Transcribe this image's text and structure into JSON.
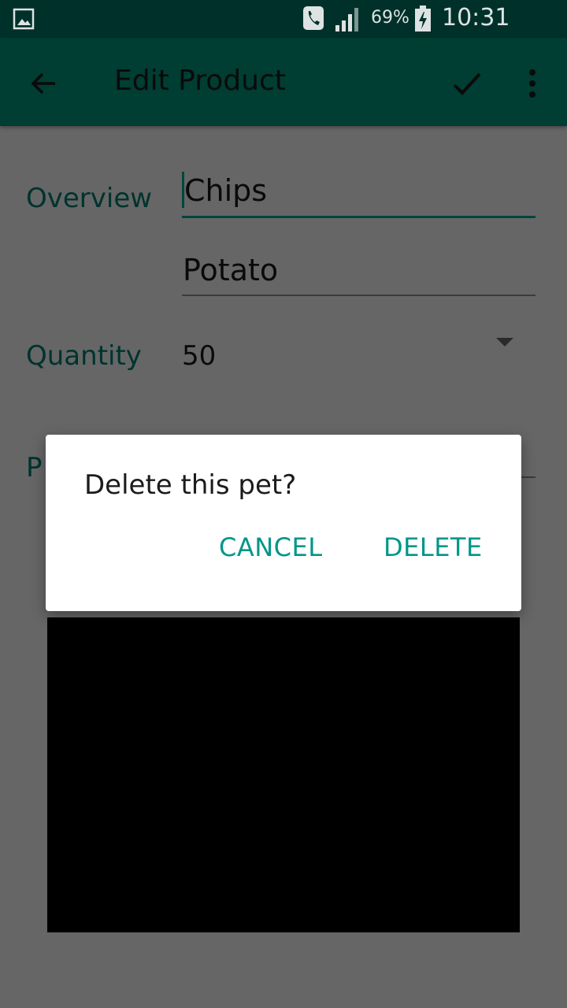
{
  "status_bar": {
    "battery_percent": "69%",
    "time": "10:31 p.m.",
    "icons": [
      "gallery-icon",
      "phone-call-icon",
      "signal-icon",
      "battery-charging-icon"
    ]
  },
  "toolbar": {
    "title": "Edit Product",
    "icons": [
      "back-arrow-icon",
      "check-icon",
      "more-vert-icon"
    ]
  },
  "form": {
    "overview_label": "Overview",
    "name_value": "Chips",
    "description_value": "Potato",
    "quantity_label": "Quantity",
    "quantity_value": "50",
    "price_label_partial": "P"
  },
  "dialog": {
    "message": "Delete this pet?",
    "cancel_label": "CANCEL",
    "delete_label": "DELETE"
  },
  "colors": {
    "primary_dark": "#00302a",
    "primary": "#003d33",
    "accent": "#009688",
    "scrim_background": "#666666"
  }
}
